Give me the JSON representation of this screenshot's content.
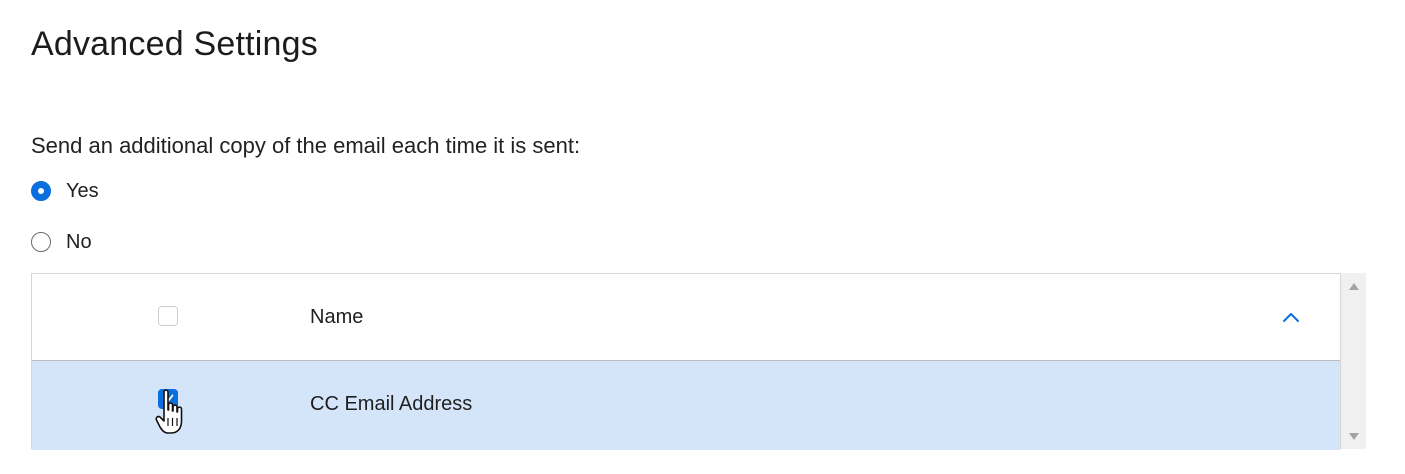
{
  "page": {
    "title": "Advanced Settings"
  },
  "cc_setting": {
    "question": "Send an additional copy of the email each time it is sent:",
    "options": [
      {
        "label": "Yes",
        "selected": true
      },
      {
        "label": "No",
        "selected": false
      }
    ]
  },
  "table": {
    "header": {
      "name_label": "Name",
      "select_all_checked": false,
      "sort_icon": "chevron-up-icon"
    },
    "rows": [
      {
        "name": "CC Email Address",
        "checked": true,
        "selected": true
      }
    ]
  },
  "colors": {
    "accent": "#0a6ede",
    "row_selected": "#d4e5fa",
    "scrollbar_track": "#f0f0f0"
  }
}
